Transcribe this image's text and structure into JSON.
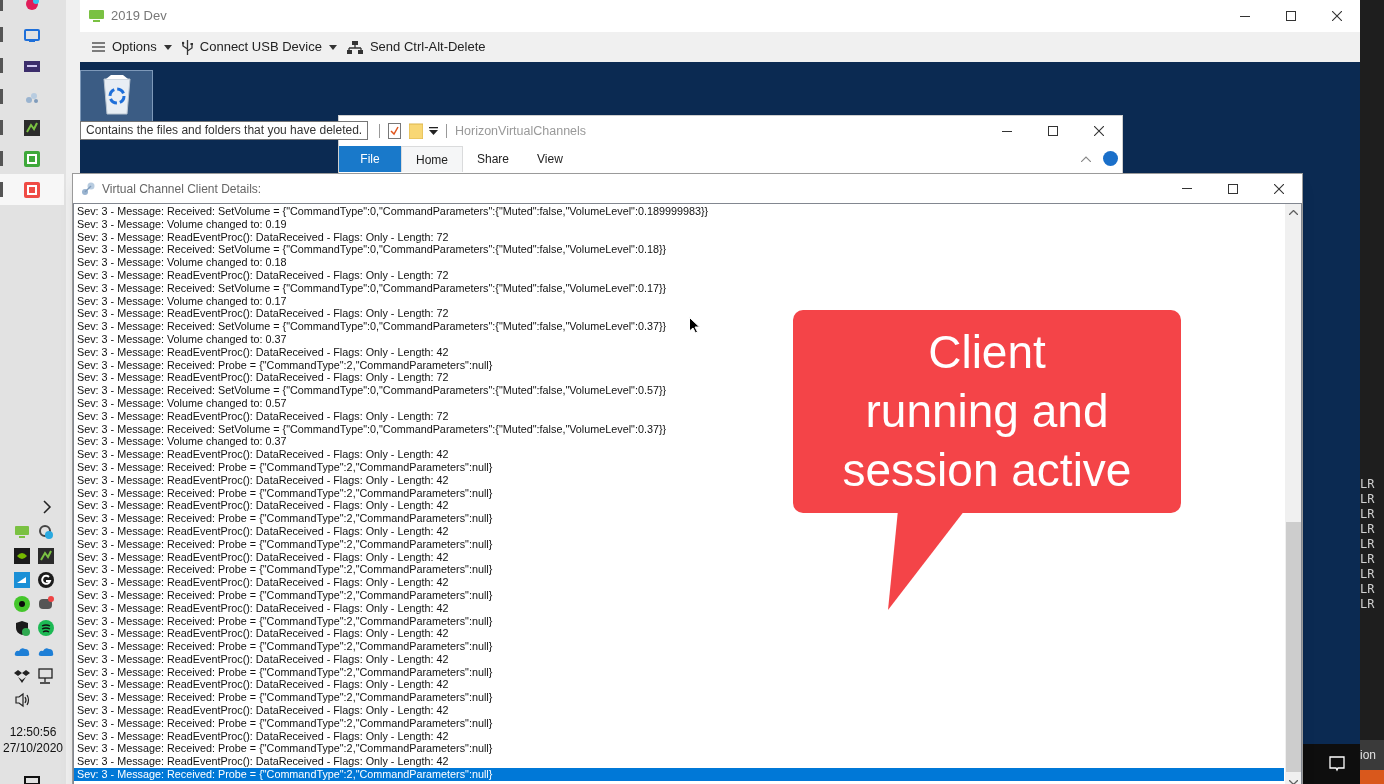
{
  "local_taskbar": {
    "pinned_apps": [
      {
        "running": true,
        "selected": false
      },
      {
        "running": true,
        "selected": false
      },
      {
        "running": true,
        "selected": false
      },
      {
        "running": true,
        "selected": false
      },
      {
        "running": true,
        "selected": false
      },
      {
        "running": true,
        "selected": false
      },
      {
        "running": true,
        "selected": true
      }
    ],
    "clock": {
      "time": "12:50:56",
      "date": "27/10/2020"
    }
  },
  "remote_window": {
    "title": "2019 Dev",
    "toolbar": [
      {
        "label": "Options",
        "dropdown": true
      },
      {
        "label": "Connect USB Device",
        "dropdown": true
      },
      {
        "label": "Send Ctrl-Alt-Delete",
        "dropdown": false
      }
    ]
  },
  "desktop": {
    "recycle_bin": {
      "selected": true
    },
    "tooltip": "Contains the files and folders that you have deleted."
  },
  "explorer": {
    "title": "HorizonVirtualChannels",
    "tabs": [
      {
        "label": "File",
        "kind": "file",
        "selected": false
      },
      {
        "label": "Home",
        "kind": "tab",
        "selected": true
      },
      {
        "label": "Share",
        "kind": "tab",
        "selected": false
      },
      {
        "label": "View",
        "kind": "tab",
        "selected": false
      }
    ]
  },
  "client_window": {
    "title": "Virtual Channel Client Details:",
    "log": [
      {
        "text": "Sev: 3 - Message: Received: SetVolume = {\"CommandType\":0,\"CommandParameters\":{\"Muted\":false,\"VolumeLevel\":0.189999983}}",
        "selected": false
      },
      {
        "text": "Sev: 3 - Message: Volume changed to: 0.19",
        "selected": false
      },
      {
        "text": "Sev: 3 - Message: ReadEventProc(): DataReceived - Flags: Only - Length: 72",
        "selected": false
      },
      {
        "text": "Sev: 3 - Message: Received: SetVolume = {\"CommandType\":0,\"CommandParameters\":{\"Muted\":false,\"VolumeLevel\":0.18}}",
        "selected": false
      },
      {
        "text": "Sev: 3 - Message: Volume changed to: 0.18",
        "selected": false
      },
      {
        "text": "Sev: 3 - Message: ReadEventProc(): DataReceived - Flags: Only - Length: 72",
        "selected": false
      },
      {
        "text": "Sev: 3 - Message: Received: SetVolume = {\"CommandType\":0,\"CommandParameters\":{\"Muted\":false,\"VolumeLevel\":0.17}}",
        "selected": false
      },
      {
        "text": "Sev: 3 - Message: Volume changed to: 0.17",
        "selected": false
      },
      {
        "text": "Sev: 3 - Message: ReadEventProc(): DataReceived - Flags: Only - Length: 72",
        "selected": false
      },
      {
        "text": "Sev: 3 - Message: Received: SetVolume = {\"CommandType\":0,\"CommandParameters\":{\"Muted\":false,\"VolumeLevel\":0.37}}",
        "selected": false
      },
      {
        "text": "Sev: 3 - Message: Volume changed to: 0.37",
        "selected": false
      },
      {
        "text": "Sev: 3 - Message: ReadEventProc(): DataReceived - Flags: Only - Length: 42",
        "selected": false
      },
      {
        "text": "Sev: 3 - Message: Received: Probe = {\"CommandType\":2,\"CommandParameters\":null}",
        "selected": false
      },
      {
        "text": "Sev: 3 - Message: ReadEventProc(): DataReceived - Flags: Only - Length: 72",
        "selected": false
      },
      {
        "text": "Sev: 3 - Message: Received: SetVolume = {\"CommandType\":0,\"CommandParameters\":{\"Muted\":false,\"VolumeLevel\":0.57}}",
        "selected": false
      },
      {
        "text": "Sev: 3 - Message: Volume changed to: 0.57",
        "selected": false
      },
      {
        "text": "Sev: 3 - Message: ReadEventProc(): DataReceived - Flags: Only - Length: 72",
        "selected": false
      },
      {
        "text": "Sev: 3 - Message: Received: SetVolume = {\"CommandType\":0,\"CommandParameters\":{\"Muted\":false,\"VolumeLevel\":0.37}}",
        "selected": false
      },
      {
        "text": "Sev: 3 - Message: Volume changed to: 0.37",
        "selected": false
      },
      {
        "text": "Sev: 3 - Message: ReadEventProc(): DataReceived - Flags: Only - Length: 42",
        "selected": false
      },
      {
        "text": "Sev: 3 - Message: Received: Probe = {\"CommandType\":2,\"CommandParameters\":null}",
        "selected": false
      },
      {
        "text": "Sev: 3 - Message: ReadEventProc(): DataReceived - Flags: Only - Length: 42",
        "selected": false
      },
      {
        "text": "Sev: 3 - Message: Received: Probe = {\"CommandType\":2,\"CommandParameters\":null}",
        "selected": false
      },
      {
        "text": "Sev: 3 - Message: ReadEventProc(): DataReceived - Flags: Only - Length: 42",
        "selected": false
      },
      {
        "text": "Sev: 3 - Message: Received: Probe = {\"CommandType\":2,\"CommandParameters\":null}",
        "selected": false
      },
      {
        "text": "Sev: 3 - Message: ReadEventProc(): DataReceived - Flags: Only - Length: 42",
        "selected": false
      },
      {
        "text": "Sev: 3 - Message: Received: Probe = {\"CommandType\":2,\"CommandParameters\":null}",
        "selected": false
      },
      {
        "text": "Sev: 3 - Message: ReadEventProc(): DataReceived - Flags: Only - Length: 42",
        "selected": false
      },
      {
        "text": "Sev: 3 - Message: Received: Probe = {\"CommandType\":2,\"CommandParameters\":null}",
        "selected": false
      },
      {
        "text": "Sev: 3 - Message: ReadEventProc(): DataReceived - Flags: Only - Length: 42",
        "selected": false
      },
      {
        "text": "Sev: 3 - Message: Received: Probe = {\"CommandType\":2,\"CommandParameters\":null}",
        "selected": false
      },
      {
        "text": "Sev: 3 - Message: ReadEventProc(): DataReceived - Flags: Only - Length: 42",
        "selected": false
      },
      {
        "text": "Sev: 3 - Message: Received: Probe = {\"CommandType\":2,\"CommandParameters\":null}",
        "selected": false
      },
      {
        "text": "Sev: 3 - Message: ReadEventProc(): DataReceived - Flags: Only - Length: 42",
        "selected": false
      },
      {
        "text": "Sev: 3 - Message: Received: Probe = {\"CommandType\":2,\"CommandParameters\":null}",
        "selected": false
      },
      {
        "text": "Sev: 3 - Message: ReadEventProc(): DataReceived - Flags: Only - Length: 42",
        "selected": false
      },
      {
        "text": "Sev: 3 - Message: Received: Probe = {\"CommandType\":2,\"CommandParameters\":null}",
        "selected": false
      },
      {
        "text": "Sev: 3 - Message: ReadEventProc(): DataReceived - Flags: Only - Length: 42",
        "selected": false
      },
      {
        "text": "Sev: 3 - Message: Received: Probe = {\"CommandType\":2,\"CommandParameters\":null}",
        "selected": false
      },
      {
        "text": "Sev: 3 - Message: ReadEventProc(): DataReceived - Flags: Only - Length: 42",
        "selected": false
      },
      {
        "text": "Sev: 3 - Message: Received: Probe = {\"CommandType\":2,\"CommandParameters\":null}",
        "selected": false
      },
      {
        "text": "Sev: 3 - Message: ReadEventProc(): DataReceived - Flags: Only - Length: 42",
        "selected": false
      },
      {
        "text": "Sev: 3 - Message: Received: Probe = {\"CommandType\":2,\"CommandParameters\":null}",
        "selected": false
      },
      {
        "text": "Sev: 3 - Message: ReadEventProc(): DataReceived - Flags: Only - Length: 42",
        "selected": false
      },
      {
        "text": "Sev: 3 - Message: Received: Probe = {\"CommandType\":2,\"CommandParameters\":null}",
        "selected": true
      }
    ]
  },
  "callout": {
    "lines": [
      "Client",
      "running and",
      "session active"
    ]
  },
  "background_console": {
    "lines": [
      "LR",
      "LR",
      "LR",
      "LR",
      "LR",
      "LR",
      "LR",
      "LR",
      "LR"
    ],
    "status_text": "ion"
  }
}
